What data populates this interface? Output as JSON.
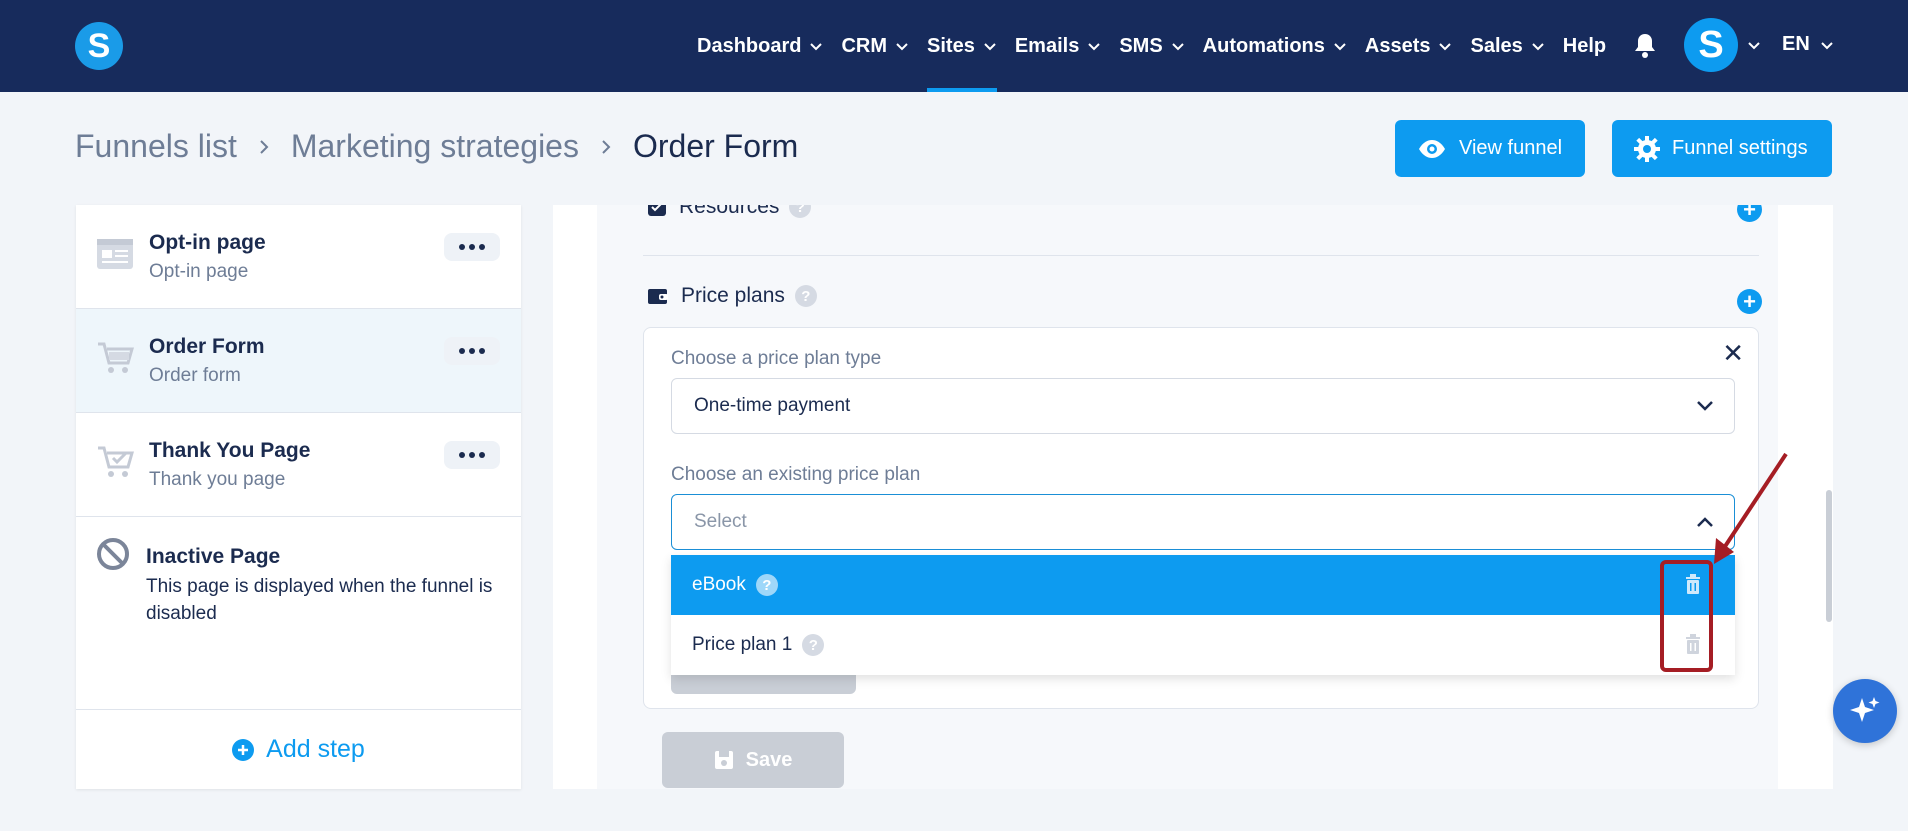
{
  "nav": {
    "logo_letter": "S",
    "items": [
      {
        "label": "Dashboard"
      },
      {
        "label": "CRM"
      },
      {
        "label": "Sites",
        "active": true
      },
      {
        "label": "Emails"
      },
      {
        "label": "SMS"
      },
      {
        "label": "Automations"
      },
      {
        "label": "Assets"
      },
      {
        "label": "Sales"
      }
    ],
    "help": "Help",
    "avatar_letter": "S",
    "lang": "EN"
  },
  "breadcrumb": {
    "items": [
      "Funnels list",
      "Marketing strategies"
    ],
    "current": "Order Form"
  },
  "actions": {
    "view_funnel": "View funnel",
    "funnel_settings": "Funnel settings"
  },
  "steps": [
    {
      "title": "Opt-in page",
      "subtitle": "Opt-in page",
      "icon": "page-layout-icon"
    },
    {
      "title": "Order Form",
      "subtitle": "Order form",
      "icon": "cart-icon"
    },
    {
      "title": "Thank You Page",
      "subtitle": "Thank you page",
      "icon": "cart-check-icon"
    }
  ],
  "inactive": {
    "title": "Inactive Page",
    "description": "This page is displayed when the funnel is disabled"
  },
  "add_step": "Add step",
  "main": {
    "resources_label": "Resources",
    "price_plans_label": "Price plans",
    "help_mark": "?",
    "plan_type_label": "Choose a price plan type",
    "plan_type_value": "One-time payment",
    "existing_plan_label": "Choose an existing price plan",
    "existing_plan_placeholder": "Select",
    "options": [
      {
        "label": "eBook",
        "selected": true
      },
      {
        "label": "Price plan 1",
        "selected": false
      }
    ],
    "save": "Save"
  },
  "colors": {
    "nav_bg": "#172b5c",
    "accent": "#0d9bf0",
    "annotation": "#a51d24"
  }
}
